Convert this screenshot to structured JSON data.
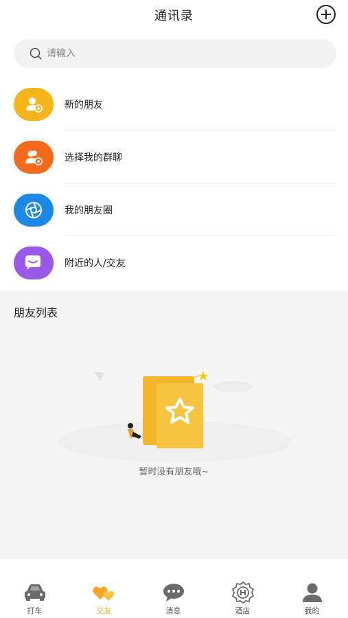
{
  "header": {
    "title": "通讯录"
  },
  "search": {
    "placeholder": "请输入"
  },
  "menu": {
    "items": [
      {
        "label": "新的朋友",
        "icon": "add-friend-icon",
        "color": "#f5b41c"
      },
      {
        "label": "选择我的群聊",
        "icon": "group-chat-icon",
        "color": "#f26a1b"
      },
      {
        "label": "我的朋友圈",
        "icon": "moments-shutter-icon",
        "color": "#1e88e5"
      },
      {
        "label": "附近的人/交友",
        "icon": "nearby-chat-icon",
        "color": "#9b59e8"
      }
    ]
  },
  "friends": {
    "title": "朋友列表",
    "empty_text": "暂时没有朋友哦~"
  },
  "tabbar": {
    "items": [
      {
        "label": "打车",
        "icon": "car-icon",
        "active": false
      },
      {
        "label": "交友",
        "icon": "hearts-icon",
        "active": true
      },
      {
        "label": "消息",
        "icon": "message-icon",
        "active": false
      },
      {
        "label": "酒店",
        "icon": "hotel-icon",
        "active": false
      },
      {
        "label": "我的",
        "icon": "profile-icon",
        "active": false
      }
    ]
  },
  "colors": {
    "accent": "#f5a623",
    "inactive_icon": "#6b6b6b"
  }
}
